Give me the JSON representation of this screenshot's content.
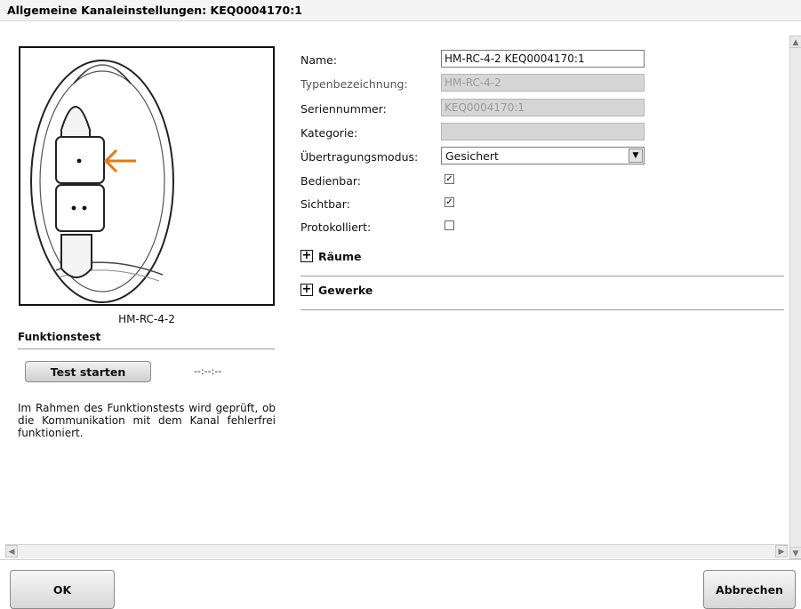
{
  "dialog": {
    "title": "Allgemeine Kanaleinstellungen: KEQ0004170:1"
  },
  "device": {
    "caption": "HM-RC-4-2"
  },
  "function_test": {
    "title": "Funktionstest",
    "button_label": "Test starten",
    "timer": "--:--:--",
    "description": "Im Rahmen des Funktionstests wird geprüft, ob die Kommunikation mit dem Kanal fehlerfrei funktioniert."
  },
  "form": {
    "name": {
      "label": "Name:",
      "value": "HM-RC-4-2 KEQ0004170:1"
    },
    "type": {
      "label": "Typenbezeichnung:",
      "value": "HM-RC-4-2"
    },
    "serial": {
      "label": "Seriennummer:",
      "value": "KEQ0004170:1"
    },
    "category": {
      "label": "Kategorie:",
      "value": ""
    },
    "transmission": {
      "label": "Übertragungsmodus:",
      "value": "Gesichert"
    },
    "operable": {
      "label": "Bedienbar:",
      "checked": true
    },
    "visible": {
      "label": "Sichtbar:",
      "checked": true
    },
    "logged": {
      "label": "Protokolliert:",
      "checked": false
    }
  },
  "sections": {
    "rooms": "Räume",
    "trades": "Gewerke"
  },
  "footer": {
    "ok": "OK",
    "cancel": "Abbrechen"
  },
  "colors": {
    "arrow": "#e07b1a",
    "readonly_bg": "#d6d6d6"
  }
}
